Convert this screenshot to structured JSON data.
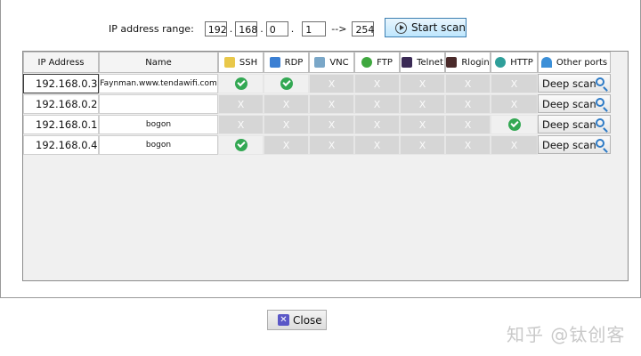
{
  "range": {
    "label": "IP address range:",
    "octets": [
      "192",
      "168",
      "0"
    ],
    "sep": ".",
    "start": "1",
    "arrow": "-->",
    "end": "254"
  },
  "scan_button": {
    "label": "Start scan",
    "icon": "play-icon"
  },
  "table": {
    "headers": {
      "ip": "IP Address",
      "name": "Name",
      "ssh": "SSH",
      "rdp": "RDP",
      "vnc": "VNC",
      "ftp": "FTP",
      "telnet": "Telnet",
      "rlogin": "Rlogin",
      "http": "HTTP",
      "other": "Other ports"
    },
    "header_icons": [
      "terminal-icon",
      "monitor-icon",
      "vnc-screen-icon",
      "ftp-icon",
      "telnet-icon",
      "rlogin-icon",
      "globe-icon",
      "wifi-icon"
    ],
    "rows": [
      {
        "ip": "192.168.0.3",
        "name": "Faynman.www.tendawifi.com",
        "ports": [
          "open",
          "open",
          "x",
          "x",
          "x",
          "x",
          "x"
        ],
        "deep": "Deep scan"
      },
      {
        "ip": "192.168.0.2",
        "name": "",
        "ports": [
          "x",
          "x",
          "x",
          "x",
          "x",
          "x",
          "x"
        ],
        "deep": "Deep scan"
      },
      {
        "ip": "192.168.0.1",
        "name": "bogon",
        "ports": [
          "x",
          "x",
          "x",
          "x",
          "x",
          "x",
          "open"
        ],
        "deep": "Deep scan"
      },
      {
        "ip": "192.168.0.4",
        "name": "bogon",
        "ports": [
          "open",
          "x",
          "x",
          "x",
          "x",
          "x",
          "x"
        ],
        "deep": "Deep scan"
      }
    ],
    "x_mark": "X"
  },
  "close_button": {
    "label": "Close"
  },
  "watermark": "知乎 @钛创客",
  "colors": {
    "open": "#33a853",
    "accent": "#3c7fb1"
  }
}
